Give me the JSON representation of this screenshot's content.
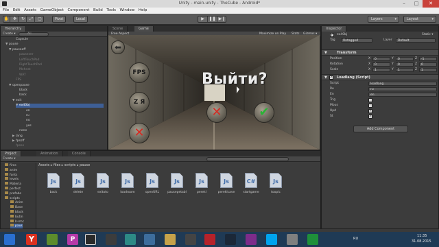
{
  "window": {
    "title": "Unity - main.unity - TheCube - Android*",
    "min": "–",
    "max": "□",
    "close": "✕"
  },
  "menu": [
    "File",
    "Edit",
    "Assets",
    "GameObject",
    "Component",
    "Build",
    "Tools",
    "Window",
    "Help"
  ],
  "toolbar": {
    "pivot": "Pivot",
    "local": "Local",
    "layers": "Layers",
    "layout": "Layout"
  },
  "hierarchy": {
    "tab": "Hierarchy",
    "create": "Create ▾",
    "search_hint": "All",
    "items": [
      {
        "label": "Capsule",
        "indent": 3,
        "state": "normal",
        "arrow": ""
      },
      {
        "label": "pause",
        "indent": 1,
        "state": "normal",
        "arrow": "▼"
      },
      {
        "label": "pauseoff",
        "indent": 2,
        "state": "normal",
        "arrow": "▼"
      },
      {
        "label": "pauseser",
        "indent": 4,
        "state": "dim",
        "arrow": ""
      },
      {
        "label": "LeftTouchPad",
        "indent": 4,
        "state": "dim",
        "arrow": ""
      },
      {
        "label": "RightTouchPad",
        "indent": 4,
        "state": "dim",
        "arrow": ""
      },
      {
        "label": "Mehnst",
        "indent": 4,
        "state": "dim",
        "arrow": ""
      },
      {
        "label": "WAT",
        "indent": 4,
        "state": "dim",
        "arrow": ""
      },
      {
        "label": "FPS",
        "indent": 3,
        "state": "dim",
        "arrow": ""
      },
      {
        "label": "openpause",
        "indent": 2,
        "state": "normal",
        "arrow": "▼"
      },
      {
        "label": "black",
        "indent": 4,
        "state": "normal",
        "arrow": ""
      },
      {
        "label": "back",
        "indent": 4,
        "state": "normal",
        "arrow": ""
      },
      {
        "label": "exit",
        "indent": 3,
        "state": "normal",
        "arrow": "▼"
      },
      {
        "label": "ex40bj",
        "indent": 4,
        "state": "sel",
        "arrow": "▼"
      },
      {
        "label": "en",
        "indent": 6,
        "state": "normal",
        "arrow": ""
      },
      {
        "label": "ru",
        "indent": 6,
        "state": "normal",
        "arrow": ""
      },
      {
        "label": "no",
        "indent": 6,
        "state": "normal",
        "arrow": ""
      },
      {
        "label": "yes",
        "indent": 6,
        "state": "normal",
        "arrow": ""
      },
      {
        "label": "none",
        "indent": 4,
        "state": "normal",
        "arrow": ""
      },
      {
        "label": "lang",
        "indent": 3,
        "state": "normal",
        "arrow": "▶"
      },
      {
        "label": "fpsoff",
        "indent": 3,
        "state": "normal",
        "arrow": "▶"
      },
      {
        "label": "fpson",
        "indent": 3,
        "state": "dim",
        "arrow": ""
      }
    ]
  },
  "scene": {
    "tab_scene": "Scene",
    "tab_game": "Game",
    "aspect": "Free Aspect",
    "maximize": "Maximize on Play",
    "stats": "Stats",
    "gizmos": "Gizmos ▾"
  },
  "game": {
    "question": "Выйти?",
    "fps": "FPS",
    "lang": "Z Я",
    "close_x": "✕",
    "confirm_x": "✕",
    "confirm_check": "✔",
    "back_arrow": "⬅"
  },
  "inspector": {
    "tab": "Inspector",
    "object_name": "ex40bj",
    "static": "Static ▾",
    "tag_label": "Tag",
    "tag_value": "Untagged",
    "layer_label": "Layer",
    "layer_value": "Default",
    "transform": "Transform",
    "rows": [
      {
        "label": "Position",
        "x": "0",
        "y": "0",
        "z": "-1"
      },
      {
        "label": "Rotation",
        "x": "0",
        "y": "0",
        "z": "0"
      },
      {
        "label": "Scale",
        "x": "1",
        "y": "1",
        "z": "1"
      }
    ],
    "script_section": "Loadlang (Script)",
    "script_label": "Script",
    "script_value": "loadlang",
    "fields": [
      {
        "label": "Ru",
        "value": "ru"
      },
      {
        "label": "En",
        "value": "en"
      }
    ],
    "checks": [
      {
        "label": "Trig",
        "checked": false
      },
      {
        "label": "Mous",
        "checked": false
      },
      {
        "label": "Upd",
        "checked": true
      },
      {
        "label": "St",
        "checked": true
      }
    ],
    "add_component": "Add Component"
  },
  "project": {
    "tab": "Project",
    "tab_animation": "Animation",
    "tab_console": "Console",
    "create": "Create ▾",
    "breadcrumb": "Assets ▸ files ▸ scripts ▸ pause",
    "tree": [
      "fires",
      "anim",
      "fonts",
      "levels",
      "Materia",
      "perfect",
      "prefabs",
      "scripts",
      "Anim",
      "Base",
      "black",
      "butin",
      "Ir-rmc",
      "paus"
    ],
    "assets": [
      {
        "label": "back",
        "kind": "Js"
      },
      {
        "label": "delete",
        "kind": "Js"
      },
      {
        "label": "exitoto",
        "kind": "Js"
      },
      {
        "label": "loadroom",
        "kind": "Js"
      },
      {
        "label": "openURL",
        "kind": "Js"
      },
      {
        "label": "pausepetabl",
        "kind": "Js"
      },
      {
        "label": "perekl",
        "kind": "Js"
      },
      {
        "label": "pereklcave",
        "kind": "Js"
      },
      {
        "label": "startgame",
        "kind": "C#"
      },
      {
        "label": "toopic",
        "kind": "Js"
      }
    ]
  },
  "taskbar": {
    "lang": "RU",
    "time": "11:35",
    "date": "31.08.2015"
  }
}
